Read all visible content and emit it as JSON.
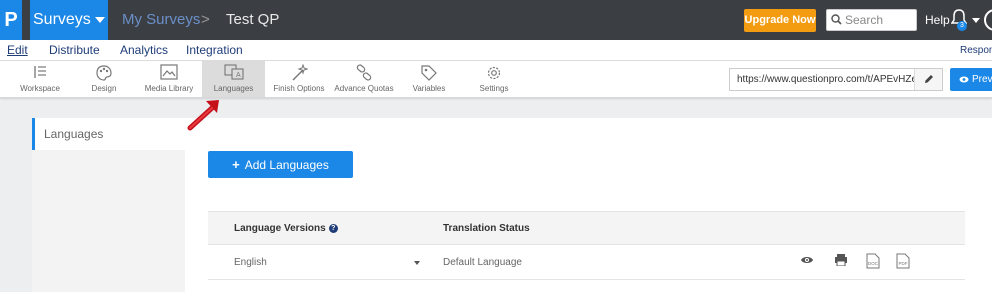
{
  "topbar": {
    "logo": "P",
    "product": "Surveys",
    "breadcrumb_my": "My Surveys",
    "breadcrumb_sep": ">",
    "breadcrumb_current": "Test QP",
    "upgrade_label": "Upgrade Now",
    "search_placeholder": "Search",
    "help_label": "Help",
    "notification_count": "3"
  },
  "menu": {
    "items": [
      "Edit",
      "Distribute",
      "Analytics",
      "Integration"
    ],
    "right_label": "Respons"
  },
  "toolbar": {
    "items": [
      {
        "label": "Workspace",
        "icon": "workspace-icon"
      },
      {
        "label": "Design",
        "icon": "palette-icon"
      },
      {
        "label": "Media Library",
        "icon": "image-icon"
      },
      {
        "label": "Languages",
        "icon": "translate-icon"
      },
      {
        "label": "Finish Options",
        "icon": "wand-icon"
      },
      {
        "label": "Advance Quotas",
        "icon": "link-icon"
      },
      {
        "label": "Variables",
        "icon": "tag-icon"
      },
      {
        "label": "Settings",
        "icon": "gear-icon"
      }
    ],
    "url_value": "https://www.questionpro.com/t/APEvHZeb",
    "preview_label": "Previ"
  },
  "sidebar": {
    "items": [
      "Languages"
    ]
  },
  "main": {
    "add_button_label": "Add Languages",
    "columns": [
      "Language Versions",
      "Translation Status"
    ],
    "rows": [
      {
        "language": "English",
        "status": "Default Language"
      }
    ]
  },
  "colors": {
    "brand_blue": "#1b87e6",
    "topbar_bg": "#3b3f44",
    "upgrade_orange": "#f39c12",
    "annotation_red": "#e0141c"
  }
}
